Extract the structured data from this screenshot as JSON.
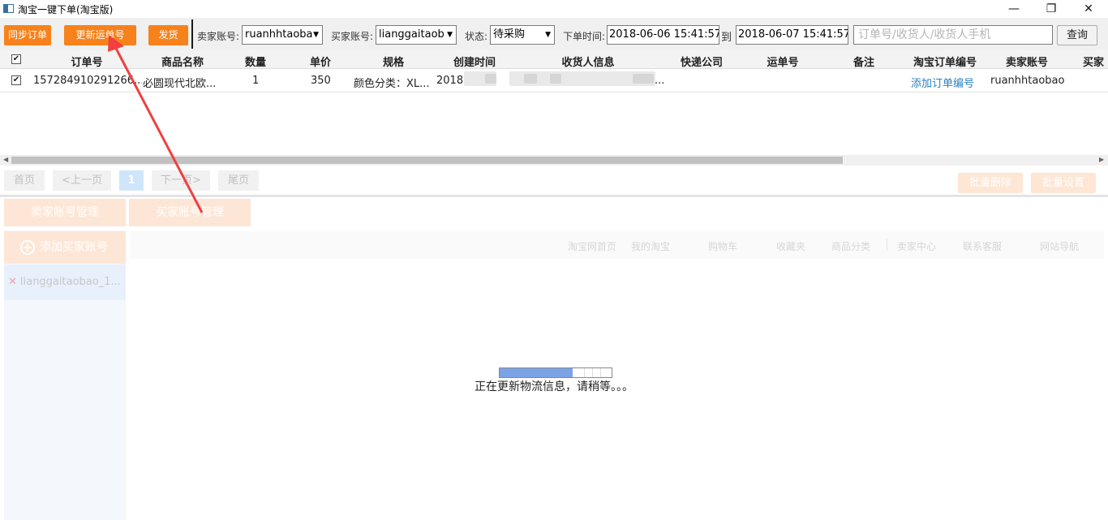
{
  "window": {
    "title": "淘宝一键下单(淘宝版)",
    "minimize": "—",
    "restore": "❐",
    "close": "✕"
  },
  "toolbar": {
    "sync_label": "同步订单",
    "update_label": "更新运单号",
    "ship_label": "发货",
    "seller_label": "卖家账号:",
    "seller_value": "ruanhhtaoba",
    "buyer_label": "买家账号:",
    "buyer_value": "lianggaitaob",
    "status_label": "状态:",
    "status_value": "待采购",
    "time_label": "下单时间:",
    "time_from": "2018-06-06 15:41:57",
    "to_label": "到",
    "time_to": "2018-06-07 15:41:57",
    "search_placeholder": "订单号/收货人/收货人手机",
    "query_label": "查询"
  },
  "table": {
    "headers": [
      "订单号",
      "商品名称",
      "数量",
      "单价",
      "规格",
      "创建时间",
      "收货人信息",
      "快递公司",
      "运单号",
      "备注",
      "淘宝订单编号",
      "卖家账号",
      "买家"
    ],
    "row": {
      "order_no": "157284910291266...",
      "product": "必圆现代北欧...",
      "qty": "1",
      "price": "350",
      "spec": "颜色分类：XL...",
      "created": "2018",
      "recipient_tail": "...",
      "taobao_order": "添加订单编号",
      "seller": "ruanhhtaobao"
    }
  },
  "pagination": {
    "first": "首页",
    "prev": "<上一页",
    "page": "1",
    "next": "下一页>",
    "last": "尾页"
  },
  "actions": {
    "batch_delete": "批量删除",
    "batch_settings": "批量设置"
  },
  "tabs": {
    "seller_mgmt": "卖家账号管理",
    "buyer_mgmt": "买家账号管理"
  },
  "sidebar": {
    "add_label": "添加买家账号",
    "account": "lianggaitaobao_1..."
  },
  "nav": [
    "淘宝网首页",
    "我的淘宝",
    "购物车",
    "收藏夹",
    "商品分类",
    "卖家中心",
    "联系客服",
    "网站导航"
  ],
  "loading": {
    "text": "正在更新物流信息，请稍等。。。",
    "progress": 0.65
  },
  "colors": {
    "accent": "#f7821c",
    "link": "#2a7fc0",
    "progress": "#7ca2e6",
    "annotation_arrow": "#f04040"
  }
}
